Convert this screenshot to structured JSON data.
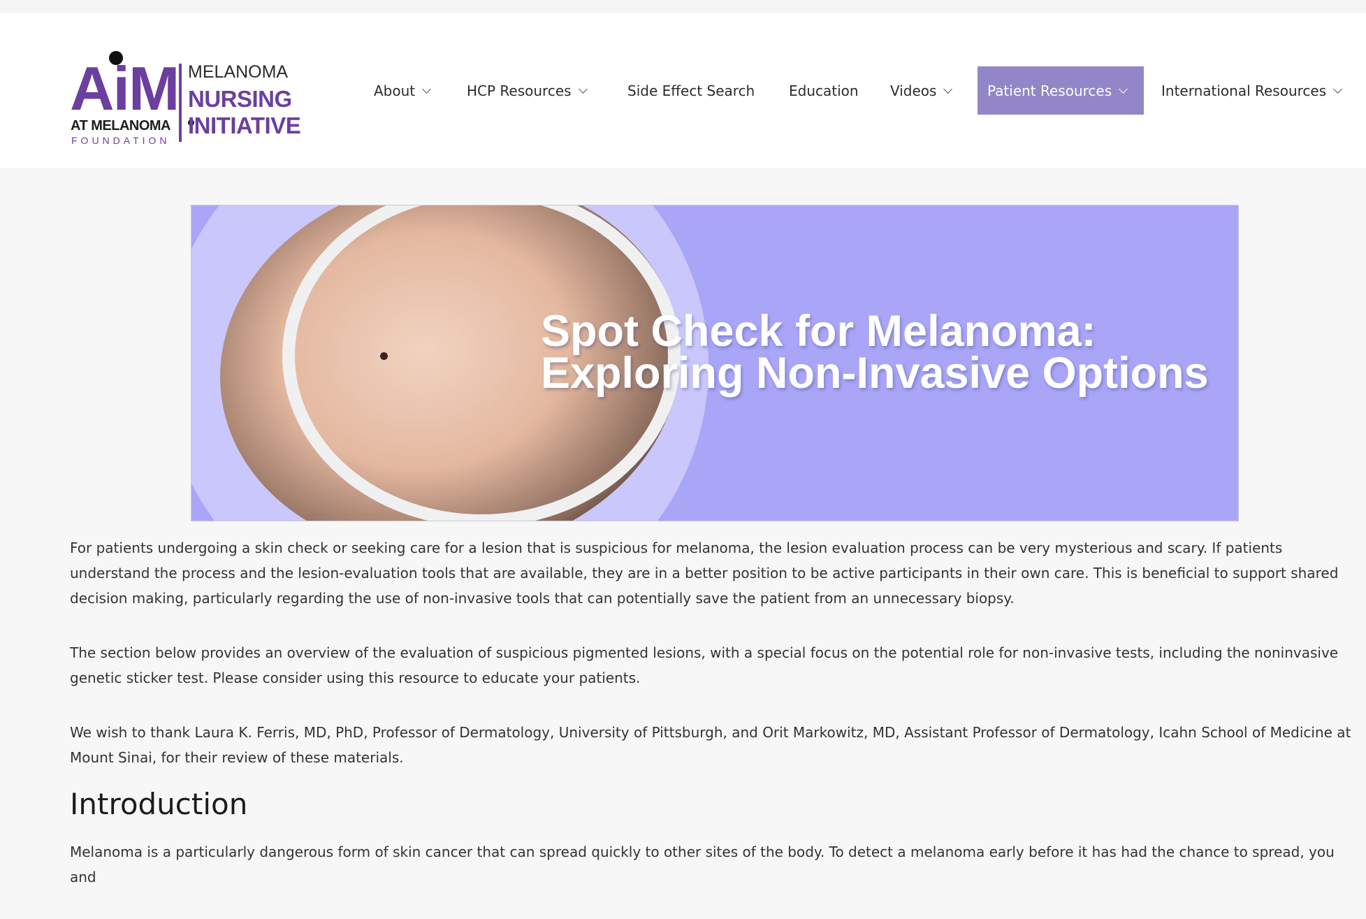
{
  "logo": {
    "aim": "AiM",
    "at_melanoma": "AT MELANOMA",
    "foundation": "FOUNDATION",
    "line1": "MELANOMA",
    "line2": "NURSING",
    "line3": "INITIATIVE",
    "brand_color": "#6b3fa0"
  },
  "nav": {
    "items": [
      {
        "label": "About",
        "has_dropdown": true
      },
      {
        "label": "HCP Resources",
        "has_dropdown": true
      },
      {
        "label": "Side Effect Search",
        "has_dropdown": false
      },
      {
        "label": "Education",
        "has_dropdown": false
      },
      {
        "label": "Videos",
        "has_dropdown": true
      },
      {
        "label": "Patient Resources",
        "has_dropdown": true,
        "active": true
      },
      {
        "label": "International Resources",
        "has_dropdown": true
      }
    ],
    "active_color": "#9286c9"
  },
  "banner": {
    "title_line1": "Spot Check for Melanoma:",
    "title_line2": "Exploring Non-Invasive Options",
    "background_color": "#a9a6f8"
  },
  "content": {
    "p1": "For patients undergoing a skin check or seeking care for a lesion that is suspicious for melanoma, the lesion evaluation process can be very mysterious and scary. If patients understand the process and the lesion-evaluation tools that are available, they are in a better position to be active participants in their own care. This is beneficial to support shared decision making, particularly regarding the use of non-invasive tools that can potentially save the patient from an unnecessary biopsy.",
    "p2": "The section below provides an overview of the evaluation of suspicious pigmented lesions, with a special focus on the potential role for non-invasive tests, including the noninvasive genetic sticker test. Please consider using this resource to educate your patients.",
    "p3": "We wish to thank Laura K. Ferris, MD, PhD, Professor of Dermatology, University of Pittsburgh, and Orit Markowitz, MD, Assistant Professor of Dermatology, Icahn School of Medicine at Mount Sinai, for their review of these materials.",
    "heading": "Introduction",
    "p4": "Melanoma is a particularly dangerous form of skin cancer that can spread quickly to other sites of the body. To detect a melanoma early before it has had the chance to spread, you and"
  }
}
